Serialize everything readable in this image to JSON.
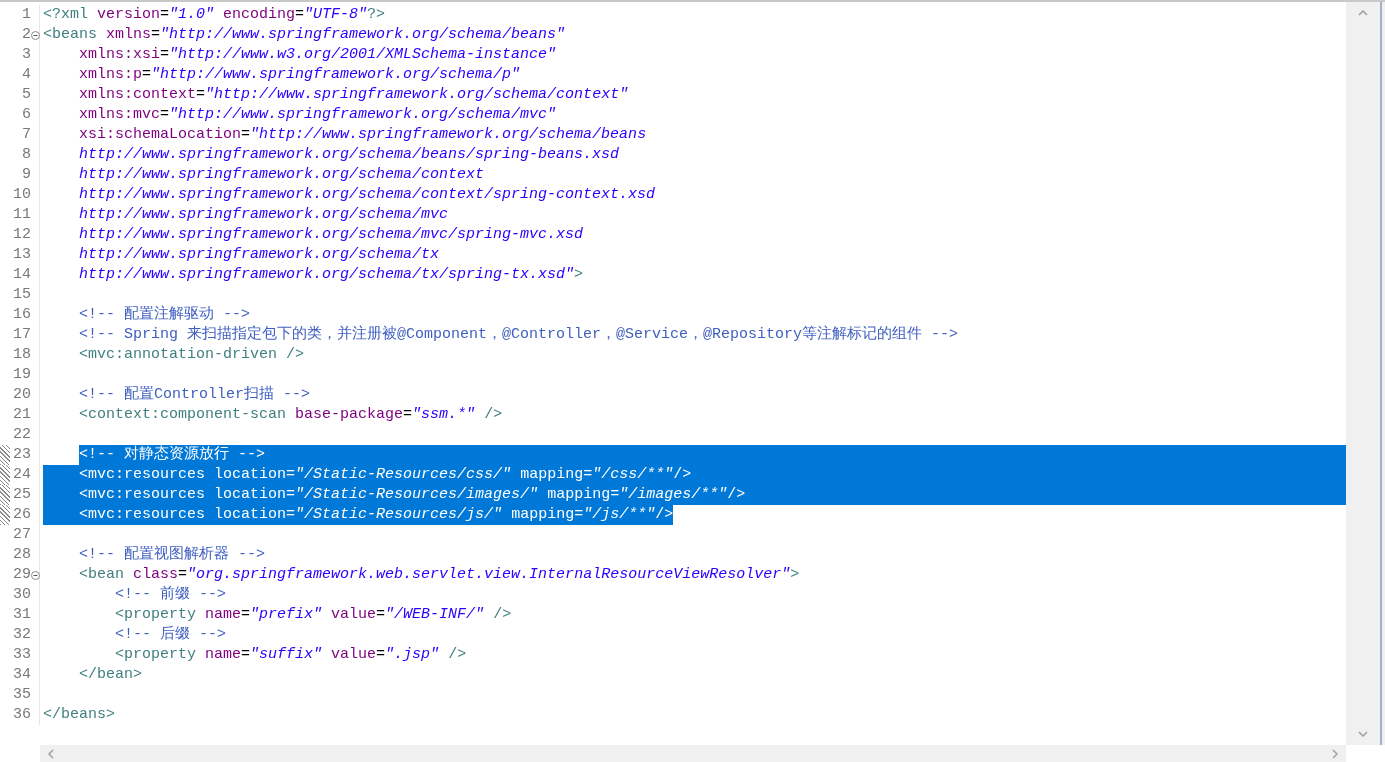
{
  "editor": {
    "lines": [
      {
        "no": "1",
        "tokens": [
          {
            "kind": "tag",
            "text": "<?xml "
          },
          {
            "kind": "attribute",
            "text": "version"
          },
          {
            "kind": "punctuation",
            "text": "="
          },
          {
            "kind": "value",
            "text": "\"1.0\" "
          },
          {
            "kind": "attribute",
            "text": "encoding"
          },
          {
            "kind": "punctuation",
            "text": "="
          },
          {
            "kind": "value",
            "text": "\"UTF-8\""
          },
          {
            "kind": "tag",
            "text": "?>"
          }
        ],
        "foldable": false,
        "changed": false,
        "selected": false
      },
      {
        "no": "2",
        "tokens": [
          {
            "kind": "tag",
            "text": "<beans "
          },
          {
            "kind": "attribute",
            "text": "xmlns"
          },
          {
            "kind": "punctuation",
            "text": "="
          },
          {
            "kind": "value",
            "text": "\"http://www.springframework.org/schema/beans\""
          }
        ],
        "foldable": true,
        "changed": false,
        "selected": false
      },
      {
        "no": "3",
        "tokens": [
          {
            "kind": "attribute",
            "text": "    xmlns:xsi"
          },
          {
            "kind": "punctuation",
            "text": "="
          },
          {
            "kind": "value",
            "text": "\"http://www.w3.org/2001/XMLSchema-instance\""
          }
        ],
        "foldable": false,
        "changed": false,
        "selected": false
      },
      {
        "no": "4",
        "tokens": [
          {
            "kind": "attribute",
            "text": "    xmlns:p"
          },
          {
            "kind": "punctuation",
            "text": "="
          },
          {
            "kind": "value",
            "text": "\"http://www.springframework.org/schema/p\""
          }
        ],
        "foldable": false,
        "changed": false,
        "selected": false
      },
      {
        "no": "5",
        "tokens": [
          {
            "kind": "attribute",
            "text": "    xmlns:context"
          },
          {
            "kind": "punctuation",
            "text": "="
          },
          {
            "kind": "value",
            "text": "\"http://www.springframework.org/schema/context\""
          }
        ],
        "foldable": false,
        "changed": false,
        "selected": false
      },
      {
        "no": "6",
        "tokens": [
          {
            "kind": "attribute",
            "text": "    xmlns:mvc"
          },
          {
            "kind": "punctuation",
            "text": "="
          },
          {
            "kind": "value",
            "text": "\"http://www.springframework.org/schema/mvc\""
          }
        ],
        "foldable": false,
        "changed": false,
        "selected": false
      },
      {
        "no": "7",
        "tokens": [
          {
            "kind": "attribute",
            "text": "    xsi:schemaLocation"
          },
          {
            "kind": "punctuation",
            "text": "="
          },
          {
            "kind": "value",
            "text": "\"http://www.springframework.org/schema/beans"
          }
        ],
        "foldable": false,
        "changed": false,
        "selected": false
      },
      {
        "no": "8",
        "tokens": [
          {
            "kind": "value",
            "text": "    http://www.springframework.org/schema/beans/spring-beans.xsd"
          }
        ],
        "foldable": false,
        "changed": false,
        "selected": false
      },
      {
        "no": "9",
        "tokens": [
          {
            "kind": "value",
            "text": "    http://www.springframework.org/schema/context"
          }
        ],
        "foldable": false,
        "changed": false,
        "selected": false
      },
      {
        "no": "10",
        "tokens": [
          {
            "kind": "value",
            "text": "    http://www.springframework.org/schema/context/spring-context.xsd"
          }
        ],
        "foldable": false,
        "changed": false,
        "selected": false
      },
      {
        "no": "11",
        "tokens": [
          {
            "kind": "value",
            "text": "    http://www.springframework.org/schema/mvc"
          }
        ],
        "foldable": false,
        "changed": false,
        "selected": false
      },
      {
        "no": "12",
        "tokens": [
          {
            "kind": "value",
            "text": "    http://www.springframework.org/schema/mvc/spring-mvc.xsd"
          }
        ],
        "foldable": false,
        "changed": false,
        "selected": false
      },
      {
        "no": "13",
        "tokens": [
          {
            "kind": "value",
            "text": "    http://www.springframework.org/schema/tx"
          }
        ],
        "foldable": false,
        "changed": false,
        "selected": false
      },
      {
        "no": "14",
        "tokens": [
          {
            "kind": "value",
            "text": "    http://www.springframework.org/schema/tx/spring-tx.xsd\""
          },
          {
            "kind": "tag",
            "text": ">"
          }
        ],
        "foldable": false,
        "changed": false,
        "selected": false
      },
      {
        "no": "15",
        "foldable": false,
        "changed": false,
        "selected": false
      },
      {
        "no": "16",
        "tokens": [
          {
            "kind": "comment",
            "text": "    <!-- 配置注解驱动 -->"
          }
        ],
        "foldable": false,
        "changed": false,
        "selected": false
      },
      {
        "no": "17",
        "tokens": [
          {
            "kind": "comment",
            "text": "    <!-- Spring 来扫描指定包下的类，并注册被@Component，@Controller，@Service，@Repository等注解标记的组件 -->"
          }
        ],
        "foldable": false,
        "changed": false,
        "selected": false
      },
      {
        "no": "18",
        "tokens": [
          {
            "kind": "tag",
            "text": "    <mvc:annotation-driven />"
          }
        ],
        "foldable": false,
        "changed": false,
        "selected": false
      },
      {
        "no": "19",
        "foldable": false,
        "changed": false,
        "selected": false
      },
      {
        "no": "20",
        "tokens": [
          {
            "kind": "comment",
            "text": "    <!-- 配置Controller扫描 -->"
          }
        ],
        "foldable": false,
        "changed": false,
        "selected": false
      },
      {
        "no": "21",
        "tokens": [
          {
            "kind": "tag",
            "text": "    <context:component-scan "
          },
          {
            "kind": "attribute",
            "text": "base-package"
          },
          {
            "kind": "punctuation",
            "text": "="
          },
          {
            "kind": "value",
            "text": "\"ssm.*\""
          },
          {
            "kind": "tag",
            "text": " />"
          }
        ],
        "foldable": false,
        "changed": false,
        "selected": false
      },
      {
        "no": "22",
        "foldable": false,
        "changed": false,
        "selected": false
      },
      {
        "no": "23",
        "tokens": [
          {
            "kind": "comment",
            "text": "    <!-- 对静态资源放行 -->"
          }
        ],
        "foldable": false,
        "changed": true,
        "selected": true
      },
      {
        "no": "24",
        "tokens": [
          {
            "kind": "tag",
            "text": "    <mvc:resources "
          },
          {
            "kind": "attribute",
            "text": "location"
          },
          {
            "kind": "punctuation",
            "text": "="
          },
          {
            "kind": "value",
            "text": "\"/Static-Resources/css/\" "
          },
          {
            "kind": "attribute",
            "text": "mapping"
          },
          {
            "kind": "punctuation",
            "text": "="
          },
          {
            "kind": "value",
            "text": "\"/css/**\""
          },
          {
            "kind": "tag",
            "text": "/>"
          }
        ],
        "foldable": false,
        "changed": true,
        "selected": true
      },
      {
        "no": "25",
        "tokens": [
          {
            "kind": "tag",
            "text": "    <mvc:resources "
          },
          {
            "kind": "attribute",
            "text": "location"
          },
          {
            "kind": "punctuation",
            "text": "="
          },
          {
            "kind": "value",
            "text": "\"/Static-Resources/images/\" "
          },
          {
            "kind": "attribute",
            "text": "mapping"
          },
          {
            "kind": "punctuation",
            "text": "="
          },
          {
            "kind": "value",
            "text": "\"/images/**\""
          },
          {
            "kind": "tag",
            "text": "/>"
          }
        ],
        "foldable": false,
        "changed": true,
        "selected": true
      },
      {
        "no": "26",
        "tokens": [
          {
            "kind": "tag",
            "text": "    <mvc:resources "
          },
          {
            "kind": "attribute",
            "text": "location"
          },
          {
            "kind": "punctuation",
            "text": "="
          },
          {
            "kind": "value",
            "text": "\"/Static-Resources/js/\" "
          },
          {
            "kind": "attribute",
            "text": "mapping"
          },
          {
            "kind": "punctuation",
            "text": "="
          },
          {
            "kind": "value",
            "text": "\"/js/**\""
          },
          {
            "kind": "tag",
            "text": "/>"
          }
        ],
        "foldable": false,
        "changed": true,
        "selected": true
      },
      {
        "no": "27",
        "foldable": false,
        "changed": false,
        "selected": false
      },
      {
        "no": "28",
        "tokens": [
          {
            "kind": "comment",
            "text": "    <!-- 配置视图解析器 -->"
          }
        ],
        "foldable": false,
        "changed": false,
        "selected": false
      },
      {
        "no": "29",
        "tokens": [
          {
            "kind": "tag",
            "text": "    <bean "
          },
          {
            "kind": "attribute",
            "text": "class"
          },
          {
            "kind": "punctuation",
            "text": "="
          },
          {
            "kind": "value",
            "text": "\"org.springframework.web.servlet.view.InternalResourceViewResolver\""
          },
          {
            "kind": "tag",
            "text": ">"
          }
        ],
        "foldable": true,
        "changed": false,
        "selected": false
      },
      {
        "no": "30",
        "tokens": [
          {
            "kind": "comment",
            "text": "        <!-- 前缀 -->"
          }
        ],
        "foldable": false,
        "changed": false,
        "selected": false
      },
      {
        "no": "31",
        "tokens": [
          {
            "kind": "tag",
            "text": "        <property "
          },
          {
            "kind": "attribute",
            "text": "name"
          },
          {
            "kind": "punctuation",
            "text": "="
          },
          {
            "kind": "value",
            "text": "\"prefix\" "
          },
          {
            "kind": "attribute",
            "text": "value"
          },
          {
            "kind": "punctuation",
            "text": "="
          },
          {
            "kind": "value",
            "text": "\"/WEB-INF/\""
          },
          {
            "kind": "tag",
            "text": " />"
          }
        ],
        "foldable": false,
        "changed": false,
        "selected": false
      },
      {
        "no": "32",
        "tokens": [
          {
            "kind": "comment",
            "text": "        <!-- 后缀 -->"
          }
        ],
        "foldable": false,
        "changed": false,
        "selected": false
      },
      {
        "no": "33",
        "tokens": [
          {
            "kind": "tag",
            "text": "        <property "
          },
          {
            "kind": "attribute",
            "text": "name"
          },
          {
            "kind": "punctuation",
            "text": "="
          },
          {
            "kind": "value",
            "text": "\"suffix\" "
          },
          {
            "kind": "attribute",
            "text": "value"
          },
          {
            "kind": "punctuation",
            "text": "="
          },
          {
            "kind": "value",
            "text": "\".jsp\""
          },
          {
            "kind": "tag",
            "text": " />"
          }
        ],
        "foldable": false,
        "changed": false,
        "selected": false
      },
      {
        "no": "34",
        "tokens": [
          {
            "kind": "tag",
            "text": "    </bean>"
          }
        ],
        "foldable": false,
        "changed": false,
        "selected": false
      },
      {
        "no": "35",
        "foldable": false,
        "changed": false,
        "selected": false
      },
      {
        "no": "36",
        "tokens": [
          {
            "kind": "tag",
            "text": "</beans>"
          }
        ],
        "foldable": false,
        "changed": false,
        "selected": false
      }
    ]
  }
}
